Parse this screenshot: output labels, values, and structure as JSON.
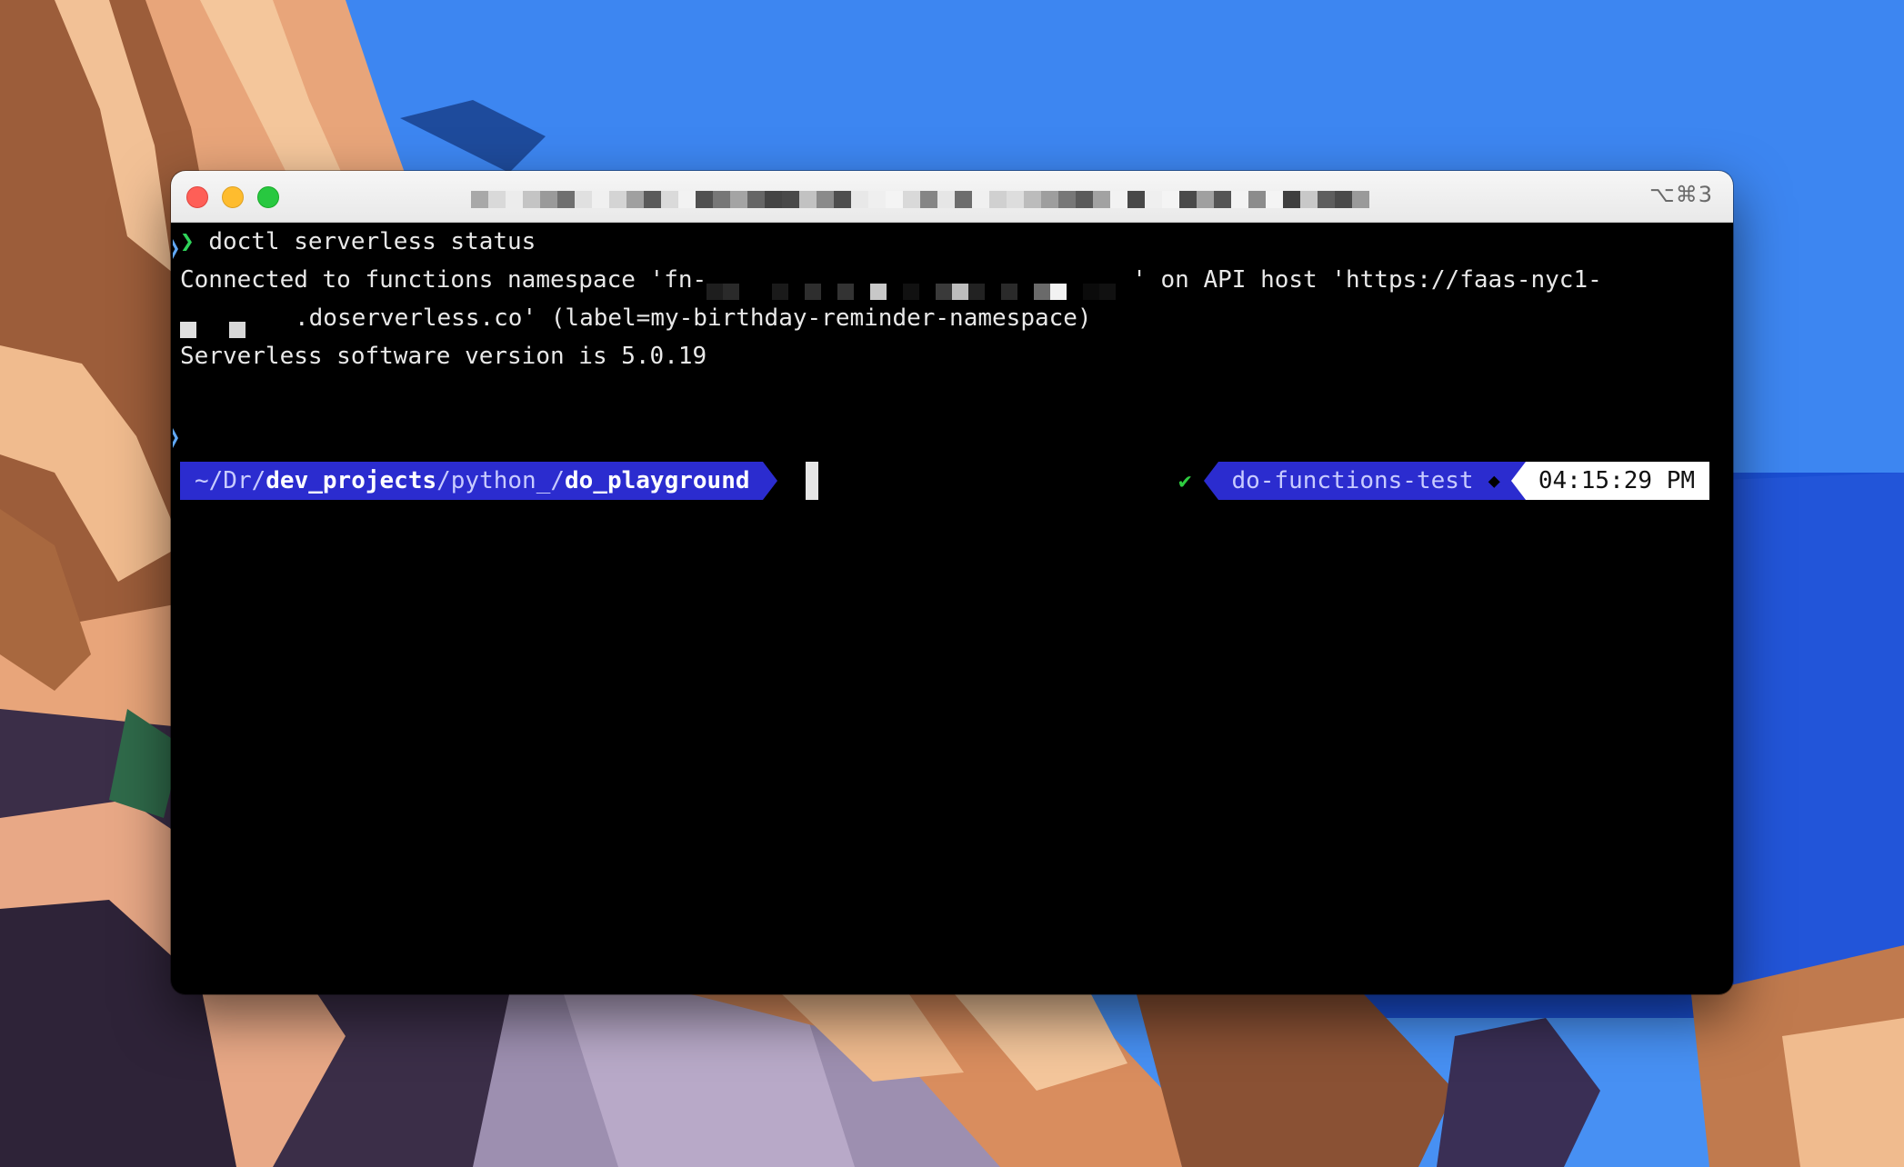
{
  "window": {
    "shortcut": "⌥⌘3"
  },
  "terminal": {
    "prompt_symbol": "❯",
    "command": "doctl serverless status",
    "output_line1_a": "Connected to functions namespace 'fn-",
    "output_line1_b": "' on API host 'https://faas-nyc1-",
    "output_line2": ".doserverless.co' (label=my-birthday-reminder-namespace)",
    "output_line3": "Serverless software version is 5.0.19",
    "path_parts": [
      {
        "text": "~/Dr/",
        "bold": false
      },
      {
        "text": "dev_projects",
        "bold": true
      },
      {
        "text": "/python_/",
        "bold": false
      },
      {
        "text": "do_playground",
        "bold": true
      }
    ],
    "status_check": "✔",
    "env_name": "do-functions-test",
    "env_icon": "◆",
    "time": "04:15:29 PM"
  },
  "colors": {
    "accent_blue": "#2b2ccf",
    "prompt_green": "#2fd35a"
  }
}
